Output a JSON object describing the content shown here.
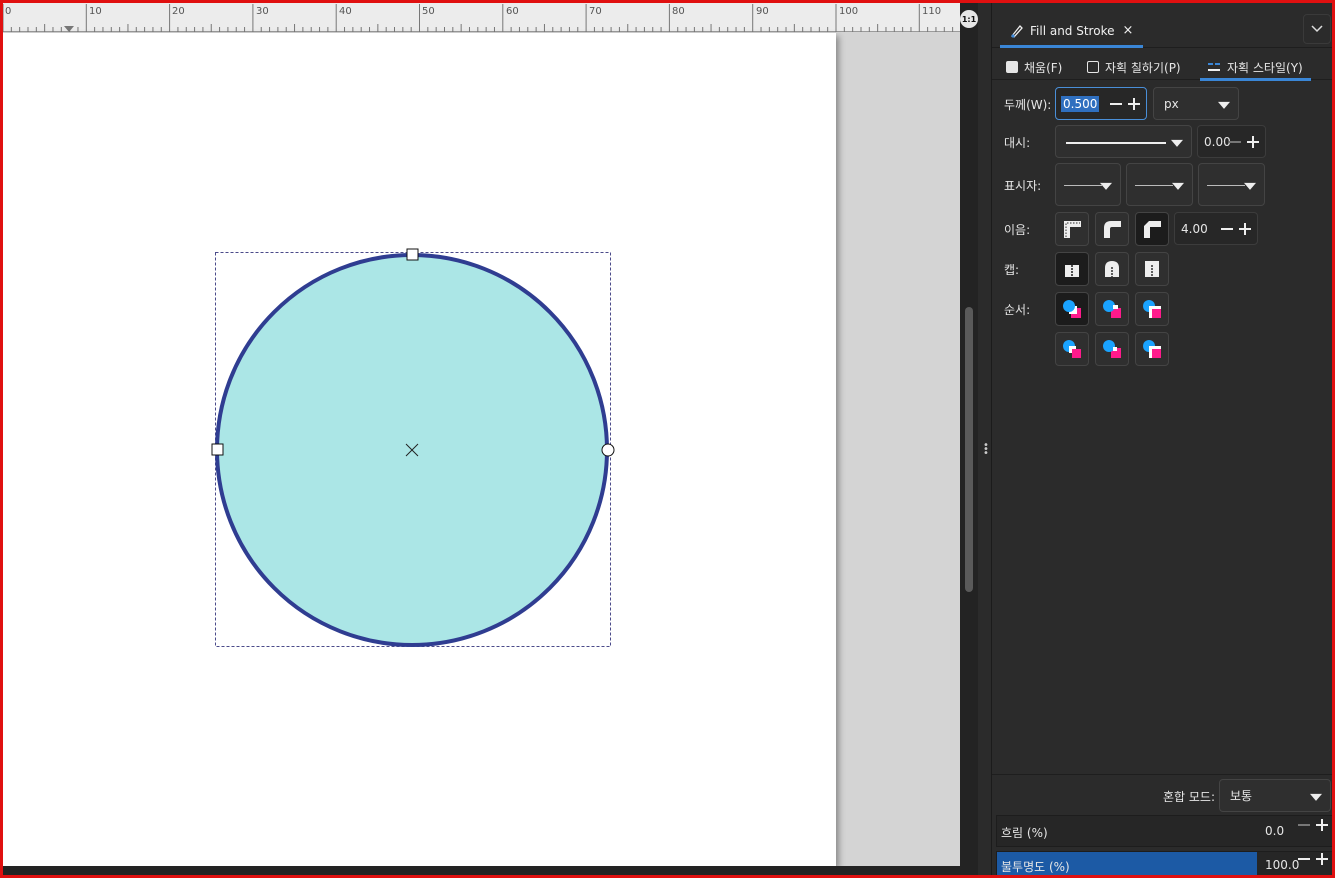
{
  "ruler": {
    "labels": [
      "0",
      "10",
      "20",
      "30",
      "40",
      "50",
      "60",
      "70",
      "80",
      "90",
      "100",
      "110"
    ]
  },
  "zoom_button": "1:1",
  "panel": {
    "tab": {
      "label": "Fill and Stroke",
      "close": "×"
    },
    "subtabs": [
      {
        "label": "채움(F)"
      },
      {
        "label": "자획 칠하기(P)"
      },
      {
        "label": "자획 스타일(Y)"
      }
    ],
    "width": {
      "label": "두께(W):",
      "value": "0.500",
      "unit": "px"
    },
    "dash": {
      "label": "대시:",
      "offset": "0.00"
    },
    "markers": {
      "label": "표시자:"
    },
    "join": {
      "label": "이음:",
      "miter": "4.00"
    },
    "cap": {
      "label": "캡:"
    },
    "order": {
      "label": "순서:"
    },
    "blend": {
      "label": "혼합 모드:",
      "value": "보통"
    },
    "blur": {
      "label": "흐림 (%)",
      "value": "0.0"
    },
    "opacity": {
      "label": "불투명도 (%)",
      "value": "100.0",
      "fraction": 1.0
    }
  },
  "colors": {
    "accent": "#3a86d6",
    "circle_fill": "#abe6e6",
    "circle_stroke": "#2f3d91",
    "frame": "#e01010"
  },
  "icons": [
    "fill-and-stroke-icon",
    "stroke-style-icon",
    "chevron-down-icon",
    "miter-join-icon",
    "round-join-icon",
    "bevel-join-icon",
    "butt-cap-icon",
    "round-cap-icon",
    "square-cap-icon",
    "paint-order-icon"
  ]
}
